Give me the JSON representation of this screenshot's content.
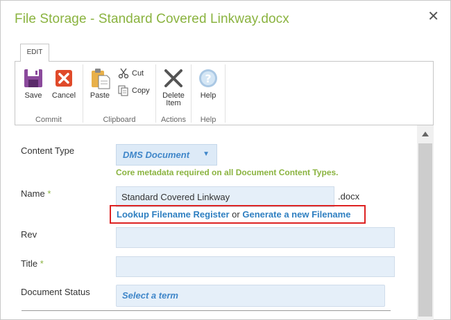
{
  "dialog": {
    "title": "File Storage - Standard Covered Linkway.docx",
    "close_glyph": "✕"
  },
  "ribbon": {
    "tab_label": "EDIT",
    "groups": {
      "commit": {
        "label": "Commit",
        "save_label": "Save",
        "cancel_label": "Cancel"
      },
      "clipboard": {
        "label": "Clipboard",
        "paste_label": "Paste",
        "cut_label": "Cut",
        "copy_label": "Copy"
      },
      "actions": {
        "label": "Actions",
        "delete_label_line1": "Delete",
        "delete_label_line2": "Item"
      },
      "help": {
        "label": "Help",
        "help_label": "Help"
      }
    }
  },
  "form": {
    "content_type": {
      "label": "Content Type",
      "value": "DMS Document",
      "hint": "Core metadata required on all Document Content Types."
    },
    "name": {
      "label": "Name",
      "required_mark": "*",
      "value": "Standard Covered Linkway",
      "extension": ".docx",
      "lookup_link": "Lookup Filename Register",
      "or_text": "or",
      "generate_link": "Generate a new Filename"
    },
    "rev": {
      "label": "Rev",
      "value": ""
    },
    "title": {
      "label": "Title",
      "required_mark": "*",
      "value": ""
    },
    "document_status": {
      "label": "Document Status",
      "placeholder": "Select a term"
    }
  },
  "colors": {
    "accent_green": "#8ab33f",
    "link_blue": "#2e7fc1",
    "highlight_red": "#dd2222"
  }
}
